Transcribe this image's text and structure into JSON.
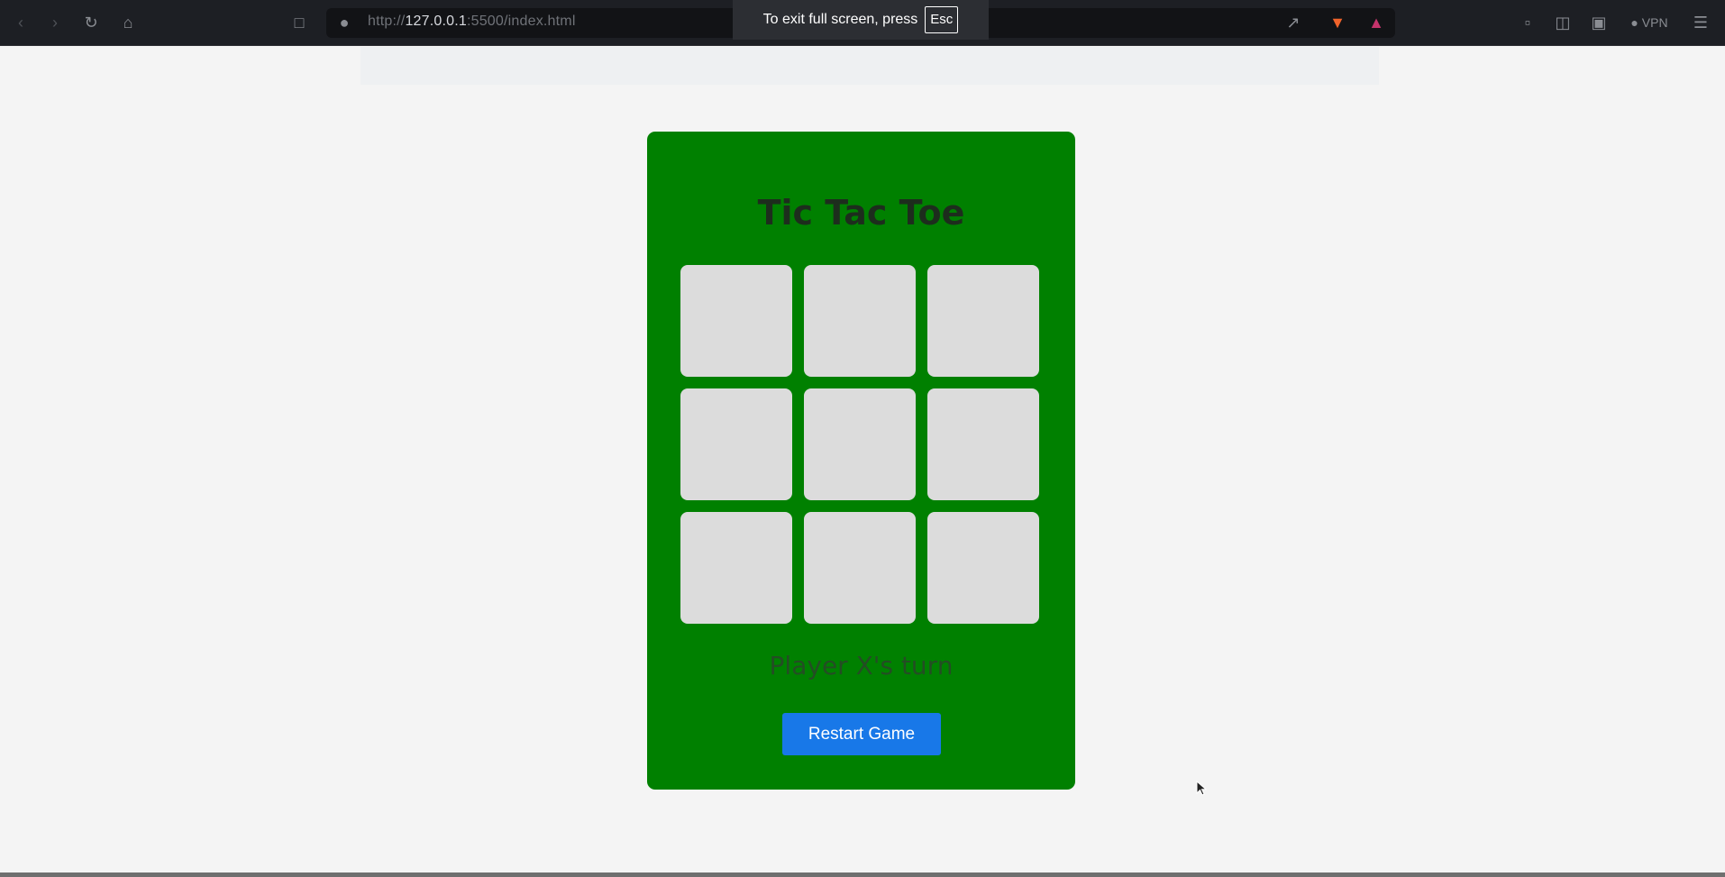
{
  "browser": {
    "address_bar": {
      "scheme": "http://",
      "host": "127.0.0.1",
      "rest": ":5500/index.html"
    },
    "fullscreen_notice": {
      "text": "To exit full screen, press",
      "key": "Esc"
    },
    "vpn_label": "VPN"
  },
  "game": {
    "title": "Tic Tac Toe",
    "cells": [
      "",
      "",
      "",
      "",
      "",
      "",
      "",
      "",
      ""
    ],
    "status": "Player X's turn",
    "restart_label": "Restart Game"
  },
  "colors": {
    "card": "#008000",
    "cell": "#dcdcdc",
    "button": "#1878e8",
    "page": "#f4f4f4"
  }
}
